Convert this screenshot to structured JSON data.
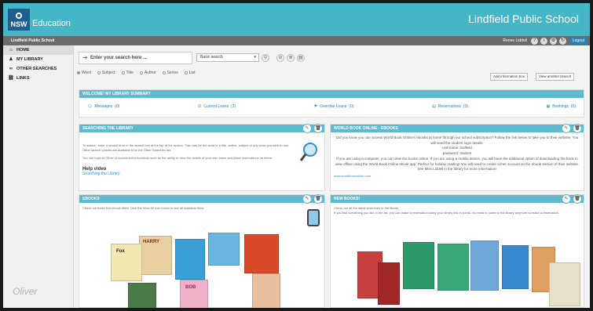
{
  "header": {
    "logo_text": "NSW",
    "education": "Education",
    "school_name": "Lindfield Public School"
  },
  "subbar": {
    "school": "Lindfield Public School",
    "user": "Renee Liddell",
    "logout": "Logout"
  },
  "sidebar": {
    "items": [
      {
        "label": "HOME",
        "icon": "home-icon"
      },
      {
        "label": "MY LIBRARY",
        "icon": "user-icon"
      },
      {
        "label": "OTHER SEARCHES",
        "icon": "binoculars-icon"
      },
      {
        "label": "LINKS",
        "icon": "link-icon"
      }
    ],
    "brand": "Oliver"
  },
  "search": {
    "placeholder": "Enter your search here ...",
    "type": "Basic search",
    "options": [
      "Word",
      "Subject",
      "Title",
      "Author",
      "Series",
      "List"
    ],
    "add_box": "Add information box",
    "view_branch": "View another branch"
  },
  "summary": {
    "title": "WELCOME! MY LIBRARY SUMMARY",
    "items": [
      {
        "label": "Messages",
        "count": "(0)"
      },
      {
        "label": "Current Loans",
        "count": "(2)"
      },
      {
        "label": "Overdue Loans",
        "count": "(0)"
      },
      {
        "label": "Reservations",
        "count": "(0)"
      },
      {
        "label": "Bookings",
        "count": "(0)"
      }
    ]
  },
  "searching_panel": {
    "title": "SEARCHING THE LIBRARY",
    "text1": "To search, enter a search term in the search box at the top of the screen. This may be the word in a title, author, subject or any word you wish to use. Other search options are available from the Other Searches list.",
    "text2": "You can login to Oliver to access extra functions such as the ability to view the details of your own loans and place reservations on items.",
    "help_title": "Help video",
    "help_link": "Searching the Library"
  },
  "world_book_panel": {
    "title": "WORLD BOOK ONLINE - EBOOKS",
    "text1": "Did you know you can access World Book Online's ebooks at home through our school subscription? Follow the link below to take you to their website. You will need the student login details:",
    "username": "username: lindfield",
    "password": "password: student",
    "text2": "If you are using a computer, you can view the books online. If you are using a mobile device, you will have the additional option of downloading the book to view offline using the World Book Online ebook app. Perfect for holiday reading! You will need to create a free account on the ebook section of their website. See Miss Liddell in the library for more information!",
    "link": "www.worldbookonline.com"
  },
  "ebooks_panel": {
    "title": "EBOOKS",
    "text": "Check out these free ebook titles! Click the View All icon below to see all available titles.",
    "book_titles": [
      "HARRY",
      "Fox",
      "BOB"
    ]
  },
  "new_books_panel": {
    "title": "NEW BOOKS!",
    "text1": "Check out all the latest resources in the library.",
    "text2": "If you find something you like in the list, you can make a reservation using your library link in portal. No need to come to the library anymore to make a reservation."
  },
  "colors": {
    "header": "#45b5c8",
    "panel_header": "#5fb9cf",
    "subbar": "#6b6b6b",
    "link": "#2f8fcf"
  }
}
